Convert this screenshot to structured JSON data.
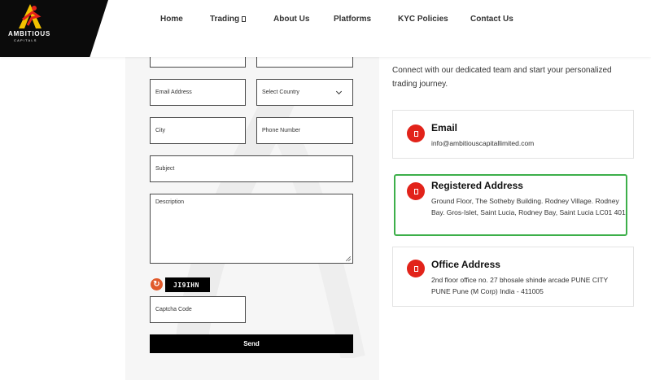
{
  "brand": {
    "name": "AMBITIOUS",
    "sub": "CAPITALS"
  },
  "nav": {
    "items": [
      "Home",
      "Trading",
      "About Us",
      "Platforms",
      "KYC Policies",
      "Contact Us"
    ]
  },
  "form": {
    "email_placeholder": "Email Address",
    "country_placeholder": "Select Country",
    "city_placeholder": "City",
    "phone_placeholder": "Phone Number",
    "subject_placeholder": "Subject",
    "description_placeholder": "Description",
    "captcha_text": "JI9IHN",
    "captcha_placeholder": "Captcha Code",
    "send_label": "Send"
  },
  "contact": {
    "intro": "Connect with our dedicated team and start your personalized trading journey.",
    "cards": [
      {
        "title": "Email",
        "text": "info@ambitiouscapitallimited.com"
      },
      {
        "title": "Registered Address",
        "text": "Ground Floor, The Sotheby Building. Rodney Village. Rodney Bay. Gros-Islet, Saint Lucia, Rodney Bay, Saint Lucia LC01 401"
      },
      {
        "title": "Office Address",
        "text": "2nd floor office no. 27 bhosale shinde arcade PUNE CITY PUNE Pune (M Corp) India - 411005"
      }
    ]
  },
  "colors": {
    "accent": "#e2231a",
    "highlight": "#3daf4a",
    "button": "#000000"
  }
}
